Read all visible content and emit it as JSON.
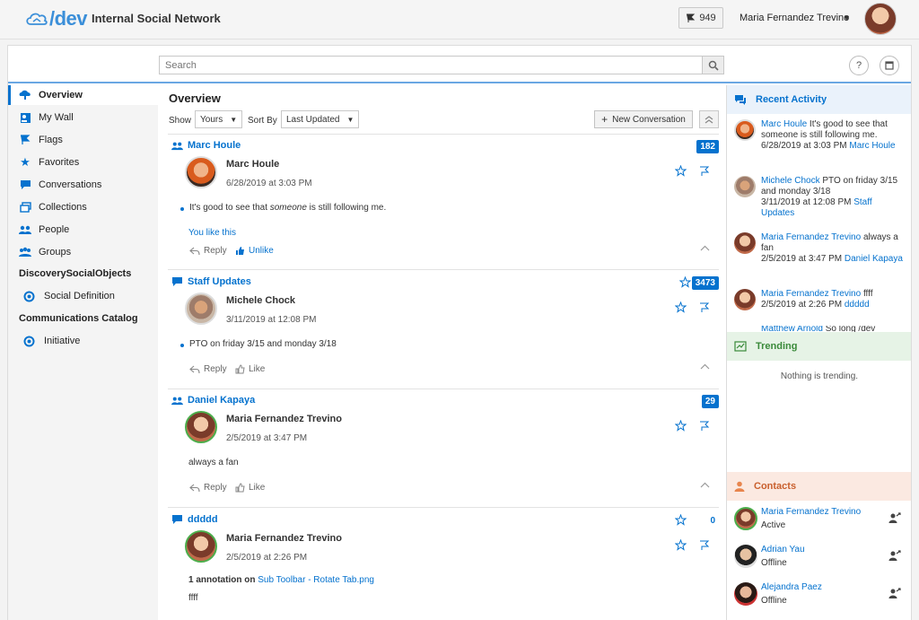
{
  "header": {
    "logo_text": "/dev",
    "app_title": "Internal Social Network",
    "flag_count": "949",
    "user_name": "Maria Fernandez Trevino"
  },
  "search": {
    "placeholder": "Search"
  },
  "nav": {
    "items": [
      {
        "label": "Overview"
      },
      {
        "label": "My Wall"
      },
      {
        "label": "Flags"
      },
      {
        "label": "Favorites"
      },
      {
        "label": "Conversations"
      },
      {
        "label": "Collections"
      },
      {
        "label": "People"
      },
      {
        "label": "Groups"
      }
    ],
    "section1": "DiscoverySocialObjects",
    "section1_items": [
      {
        "label": "Social Definition"
      }
    ],
    "section2": "Communications Catalog",
    "section2_items": [
      {
        "label": "Initiative"
      }
    ]
  },
  "overview": {
    "title": "Overview",
    "show_label": "Show",
    "show_value": "Yours",
    "sort_label": "Sort By",
    "sort_value": "Last Updated",
    "new_conversation": "New Conversation"
  },
  "posts": [
    {
      "conversation": "Marc Houle",
      "count": "182",
      "author": "Marc Houle",
      "time": "6/28/2019 at 3:03 PM",
      "text_before": "It's good to see that ",
      "text_em": "someone",
      "text_after": " is still following me.",
      "you_like": "You like this",
      "reply": "Reply",
      "like": "Unlike"
    },
    {
      "conversation": "Staff Updates",
      "count": "3473",
      "author": "Michele Chock",
      "time": "3/11/2019 at 12:08 PM",
      "text": "PTO on friday 3/15 and monday 3/18",
      "reply": "Reply",
      "like": "Like"
    },
    {
      "conversation": "Daniel Kapaya",
      "count": "29",
      "author": "Maria Fernandez Trevino",
      "time": "2/5/2019 at 3:47 PM",
      "text": "always a fan",
      "reply": "Reply",
      "like": "Like"
    },
    {
      "conversation": "ddddd",
      "count": "0",
      "author": "Maria Fernandez Trevino",
      "time": "2/5/2019 at 2:26 PM",
      "annotation_prefix": "1 annotation on",
      "annotation_link": "Sub Toolbar - Rotate Tab.png",
      "text": "ffff"
    }
  ],
  "recent_activity": {
    "title": "Recent Activity",
    "items": [
      {
        "name": "Marc Houle",
        "text": " It's good to see that someone is still following me.",
        "time": "6/28/2019 at 3:03 PM ",
        "link": "Marc Houle"
      },
      {
        "name": "Michele Chock",
        "text": " PTO on friday 3/15 and monday 3/18",
        "time": "3/11/2019 at 12:08 PM ",
        "link": "Staff Updates"
      },
      {
        "name": "Maria Fernandez Trevino",
        "text": " always a fan",
        "time": "2/5/2019 at 3:47 PM ",
        "link": "Daniel Kapaya"
      },
      {
        "name": "Maria Fernandez Trevino",
        "text": " ffff",
        "time": "2/5/2019 at 2:26 PM ",
        "link": "ddddd"
      },
      {
        "name": "Matthew Arnold",
        "text": " So long /dev",
        "time": "",
        "link": ""
      }
    ]
  },
  "trending": {
    "title": "Trending",
    "empty": "Nothing is trending."
  },
  "contacts": {
    "title": "Contacts",
    "items": [
      {
        "name": "Maria Fernandez Trevino",
        "status": "Active"
      },
      {
        "name": "Adrian Yau",
        "status": "Offline"
      },
      {
        "name": "Alejandra Paez",
        "status": "Offline"
      }
    ]
  },
  "colors": {
    "accent": "#0572ce",
    "trending_bg": "#e6f3e6",
    "contacts_bg": "#fbe9e1",
    "recent_bg": "#eaf2fb"
  }
}
